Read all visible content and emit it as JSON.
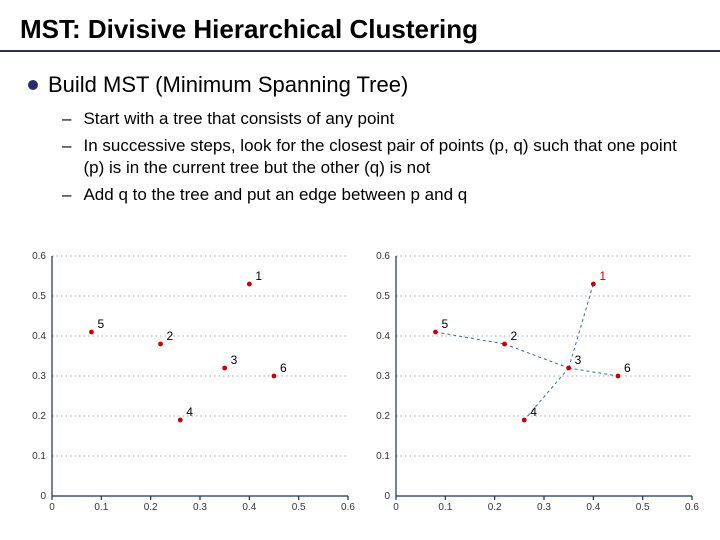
{
  "title": "MST: Divisive Hierarchical Clustering",
  "bullet_main": "Build MST (Minimum Spanning Tree)",
  "sub": {
    "a": "Start with a tree that consists of any point",
    "b": "In successive steps, look for the closest pair of points (p, q)  such that one point (p) is in the current tree but the other (q) is not",
    "c": "Add q to the tree and put an edge between p and q"
  },
  "chart_data": [
    {
      "type": "scatter",
      "xlim": [
        0,
        0.6
      ],
      "ylim": [
        0,
        0.6
      ],
      "xticks": [
        0,
        0.1,
        0.2,
        0.3,
        0.4,
        0.5,
        0.6
      ],
      "yticks": [
        0,
        0.1,
        0.2,
        0.3,
        0.4,
        0.5,
        0.6
      ],
      "grid": "y-dotted",
      "points": [
        {
          "id": "1",
          "x": 0.4,
          "y": 0.53
        },
        {
          "id": "2",
          "x": 0.22,
          "y": 0.38
        },
        {
          "id": "3",
          "x": 0.35,
          "y": 0.32
        },
        {
          "id": "4",
          "x": 0.26,
          "y": 0.19
        },
        {
          "id": "5",
          "x": 0.08,
          "y": 0.41
        },
        {
          "id": "6",
          "x": 0.45,
          "y": 0.3
        }
      ]
    },
    {
      "type": "scatter",
      "xlim": [
        0,
        0.6
      ],
      "ylim": [
        0,
        0.6
      ],
      "xticks": [
        0,
        0.1,
        0.2,
        0.3,
        0.4,
        0.5,
        0.6
      ],
      "yticks": [
        0,
        0.1,
        0.2,
        0.3,
        0.4,
        0.5,
        0.6
      ],
      "grid": "y-dotted",
      "points": [
        {
          "id": "1",
          "x": 0.4,
          "y": 0.53
        },
        {
          "id": "2",
          "x": 0.22,
          "y": 0.38
        },
        {
          "id": "3",
          "x": 0.35,
          "y": 0.32
        },
        {
          "id": "4",
          "x": 0.26,
          "y": 0.19
        },
        {
          "id": "5",
          "x": 0.08,
          "y": 0.41
        },
        {
          "id": "6",
          "x": 0.45,
          "y": 0.3
        }
      ],
      "mst_edges": [
        [
          "5",
          "2"
        ],
        [
          "2",
          "3"
        ],
        [
          "3",
          "6"
        ],
        [
          "3",
          "4"
        ],
        [
          "3",
          "1"
        ]
      ],
      "highlight_label": "1"
    }
  ]
}
